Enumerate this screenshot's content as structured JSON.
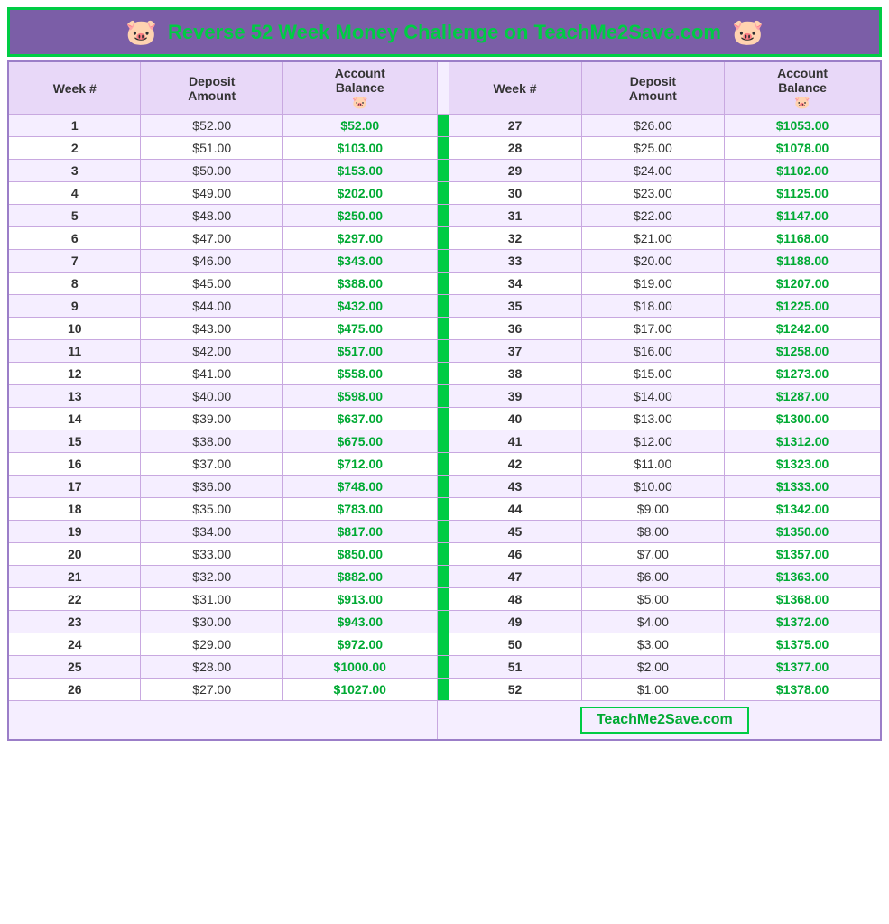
{
  "header": {
    "title": "Reverse 52 Week Money Challenge on TeachMe2Save.com",
    "pig_icon": "🐷"
  },
  "columns_left": [
    "Week #",
    "Deposit Amount",
    "Account Balance"
  ],
  "columns_right": [
    "Week #",
    "Deposit Amount",
    "Account Balance"
  ],
  "rows_left": [
    {
      "week": 1,
      "deposit": "$52.00",
      "balance": "$52.00"
    },
    {
      "week": 2,
      "deposit": "$51.00",
      "balance": "$103.00"
    },
    {
      "week": 3,
      "deposit": "$50.00",
      "balance": "$153.00"
    },
    {
      "week": 4,
      "deposit": "$49.00",
      "balance": "$202.00"
    },
    {
      "week": 5,
      "deposit": "$48.00",
      "balance": "$250.00"
    },
    {
      "week": 6,
      "deposit": "$47.00",
      "balance": "$297.00"
    },
    {
      "week": 7,
      "deposit": "$46.00",
      "balance": "$343.00"
    },
    {
      "week": 8,
      "deposit": "$45.00",
      "balance": "$388.00"
    },
    {
      "week": 9,
      "deposit": "$44.00",
      "balance": "$432.00"
    },
    {
      "week": 10,
      "deposit": "$43.00",
      "balance": "$475.00"
    },
    {
      "week": 11,
      "deposit": "$42.00",
      "balance": "$517.00"
    },
    {
      "week": 12,
      "deposit": "$41.00",
      "balance": "$558.00"
    },
    {
      "week": 13,
      "deposit": "$40.00",
      "balance": "$598.00"
    },
    {
      "week": 14,
      "deposit": "$39.00",
      "balance": "$637.00"
    },
    {
      "week": 15,
      "deposit": "$38.00",
      "balance": "$675.00"
    },
    {
      "week": 16,
      "deposit": "$37.00",
      "balance": "$712.00"
    },
    {
      "week": 17,
      "deposit": "$36.00",
      "balance": "$748.00"
    },
    {
      "week": 18,
      "deposit": "$35.00",
      "balance": "$783.00"
    },
    {
      "week": 19,
      "deposit": "$34.00",
      "balance": "$817.00"
    },
    {
      "week": 20,
      "deposit": "$33.00",
      "balance": "$850.00"
    },
    {
      "week": 21,
      "deposit": "$32.00",
      "balance": "$882.00"
    },
    {
      "week": 22,
      "deposit": "$31.00",
      "balance": "$913.00"
    },
    {
      "week": 23,
      "deposit": "$30.00",
      "balance": "$943.00"
    },
    {
      "week": 24,
      "deposit": "$29.00",
      "balance": "$972.00"
    },
    {
      "week": 25,
      "deposit": "$28.00",
      "balance": "$1000.00"
    },
    {
      "week": 26,
      "deposit": "$27.00",
      "balance": "$1027.00"
    }
  ],
  "rows_right": [
    {
      "week": 27,
      "deposit": "$26.00",
      "balance": "$1053.00"
    },
    {
      "week": 28,
      "deposit": "$25.00",
      "balance": "$1078.00"
    },
    {
      "week": 29,
      "deposit": "$24.00",
      "balance": "$1102.00"
    },
    {
      "week": 30,
      "deposit": "$23.00",
      "balance": "$1125.00"
    },
    {
      "week": 31,
      "deposit": "$22.00",
      "balance": "$1147.00"
    },
    {
      "week": 32,
      "deposit": "$21.00",
      "balance": "$1168.00"
    },
    {
      "week": 33,
      "deposit": "$20.00",
      "balance": "$1188.00"
    },
    {
      "week": 34,
      "deposit": "$19.00",
      "balance": "$1207.00"
    },
    {
      "week": 35,
      "deposit": "$18.00",
      "balance": "$1225.00"
    },
    {
      "week": 36,
      "deposit": "$17.00",
      "balance": "$1242.00"
    },
    {
      "week": 37,
      "deposit": "$16.00",
      "balance": "$1258.00"
    },
    {
      "week": 38,
      "deposit": "$15.00",
      "balance": "$1273.00"
    },
    {
      "week": 39,
      "deposit": "$14.00",
      "balance": "$1287.00"
    },
    {
      "week": 40,
      "deposit": "$13.00",
      "balance": "$1300.00"
    },
    {
      "week": 41,
      "deposit": "$12.00",
      "balance": "$1312.00"
    },
    {
      "week": 42,
      "deposit": "$11.00",
      "balance": "$1323.00"
    },
    {
      "week": 43,
      "deposit": "$10.00",
      "balance": "$1333.00"
    },
    {
      "week": 44,
      "deposit": "$9.00",
      "balance": "$1342.00"
    },
    {
      "week": 45,
      "deposit": "$8.00",
      "balance": "$1350.00"
    },
    {
      "week": 46,
      "deposit": "$7.00",
      "balance": "$1357.00"
    },
    {
      "week": 47,
      "deposit": "$6.00",
      "balance": "$1363.00"
    },
    {
      "week": 48,
      "deposit": "$5.00",
      "balance": "$1368.00"
    },
    {
      "week": 49,
      "deposit": "$4.00",
      "balance": "$1372.00"
    },
    {
      "week": 50,
      "deposit": "$3.00",
      "balance": "$1375.00"
    },
    {
      "week": 51,
      "deposit": "$2.00",
      "balance": "$1377.00"
    },
    {
      "week": 52,
      "deposit": "$1.00",
      "balance": "$1378.00"
    }
  ],
  "footer": {
    "website": "TeachMe2Save.com"
  },
  "colors": {
    "header_bg": "#7b5ea7",
    "header_text": "#00cc44",
    "divider": "#00cc44",
    "balance_text": "#00aa33",
    "table_header_bg": "#e8d8f8",
    "row_odd": "#f5eeff",
    "row_even": "#ffffff",
    "border": "#c8a8e0"
  }
}
